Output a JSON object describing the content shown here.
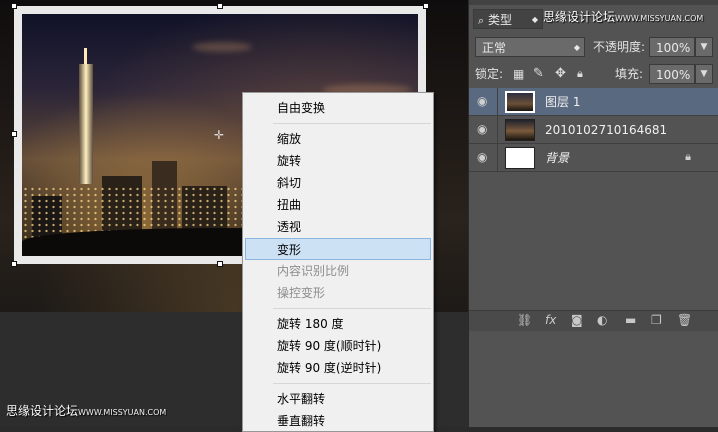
{
  "watermark": {
    "top_cn": "思缘设计论坛",
    "top_url": "WWW.MISSYUAN.COM",
    "bottom_cn": "思缘设计论坛",
    "bottom_url": "WWW.MISSYUAN.COM"
  },
  "context_menu": {
    "items": [
      {
        "label": "自由变换",
        "disabled": false,
        "highlighted": false
      },
      {
        "separator": true
      },
      {
        "label": "缩放",
        "disabled": false,
        "highlighted": false
      },
      {
        "label": "旋转",
        "disabled": false,
        "highlighted": false
      },
      {
        "label": "斜切",
        "disabled": false,
        "highlighted": false
      },
      {
        "label": "扭曲",
        "disabled": false,
        "highlighted": false
      },
      {
        "label": "透视",
        "disabled": false,
        "highlighted": false
      },
      {
        "label": "变形",
        "disabled": false,
        "highlighted": true
      },
      {
        "label": "内容识别比例",
        "disabled": true,
        "highlighted": false
      },
      {
        "label": "操控变形",
        "disabled": true,
        "highlighted": false
      },
      {
        "separator": true
      },
      {
        "label": "旋转 180 度",
        "disabled": false,
        "highlighted": false
      },
      {
        "label": "旋转 90 度(顺时针)",
        "disabled": false,
        "highlighted": false
      },
      {
        "label": "旋转 90 度(逆时针)",
        "disabled": false,
        "highlighted": false
      },
      {
        "separator": true
      },
      {
        "label": "水平翻转",
        "disabled": false,
        "highlighted": false
      },
      {
        "label": "垂直翻转",
        "disabled": false,
        "highlighted": false
      }
    ]
  },
  "layers_panel": {
    "filter_kind": "类型",
    "blend_mode": "正常",
    "opacity_label": "不透明度:",
    "opacity_value": "100%",
    "lock_label": "锁定:",
    "fill_label": "填充:",
    "fill_value": "100%",
    "layers": [
      {
        "name": "图层 1",
        "selected": true,
        "thumb": "photo-thumb",
        "locked": false
      },
      {
        "name": "2010102710164681",
        "selected": false,
        "thumb": "city-thumb",
        "locked": false
      },
      {
        "name": "背景",
        "selected": false,
        "thumb": "white-thumb",
        "locked": true
      }
    ],
    "footer_icons": [
      "link-icon",
      "fx-icon",
      "mask-icon",
      "adjustment-icon",
      "folder-icon",
      "new-layer-icon",
      "trash-icon"
    ]
  },
  "colors": {
    "selected_layer": "#596a80",
    "menu_highlight": "#cde1f5",
    "panel_bg": "#535353"
  }
}
